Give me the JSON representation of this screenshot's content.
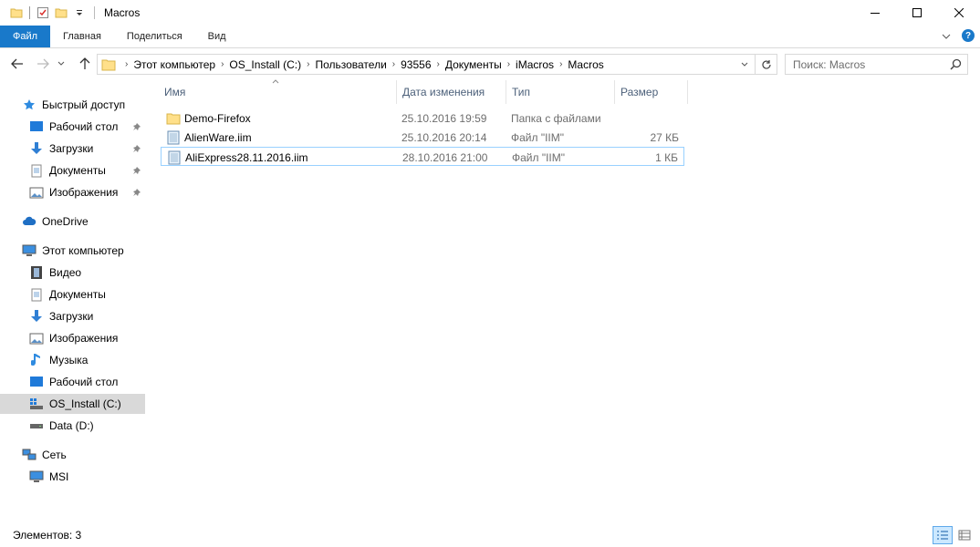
{
  "window": {
    "title": "Macros"
  },
  "ribbon": {
    "tabs": [
      "Файл",
      "Главная",
      "Поделиться",
      "Вид"
    ],
    "help_label": "?"
  },
  "address": {
    "crumbs": [
      "Этот компьютер",
      "OS_Install (C:)",
      "Пользователи",
      "93556",
      "Документы",
      "iMacros",
      "Macros"
    ]
  },
  "search": {
    "placeholder": "Поиск: Macros"
  },
  "sidebar": {
    "quick_access": "Быстрый доступ",
    "quick_items": [
      "Рабочий стол",
      "Загрузки",
      "Документы",
      "Изображения"
    ],
    "onedrive": "OneDrive",
    "this_pc": "Этот компьютер",
    "pc_items": [
      "Видео",
      "Документы",
      "Загрузки",
      "Изображения",
      "Музыка",
      "Рабочий стол",
      "OS_Install (C:)",
      "Data (D:)"
    ],
    "network": "Сеть",
    "network_items": [
      "MSI"
    ]
  },
  "columns": {
    "name": "Имя",
    "date": "Дата изменения",
    "type": "Тип",
    "size": "Размер"
  },
  "files": [
    {
      "name": "Demo-Firefox",
      "date": "25.10.2016 19:59",
      "type": "Папка с файлами",
      "size": "",
      "icon": "folder-icon"
    },
    {
      "name": "AlienWare.iim",
      "date": "25.10.2016 20:14",
      "type": "Файл \"IIM\"",
      "size": "27 КБ",
      "icon": "file-icon"
    },
    {
      "name": "AliExpress28.11.2016.iim",
      "date": "28.10.2016 21:00",
      "type": "Файл \"IIM\"",
      "size": "1 КБ",
      "icon": "file-icon"
    }
  ],
  "status": {
    "items_count": "Элементов: 3"
  },
  "colors": {
    "accent": "#1979ca",
    "selection_border": "#99d1ff",
    "header_text": "#4c607a"
  }
}
